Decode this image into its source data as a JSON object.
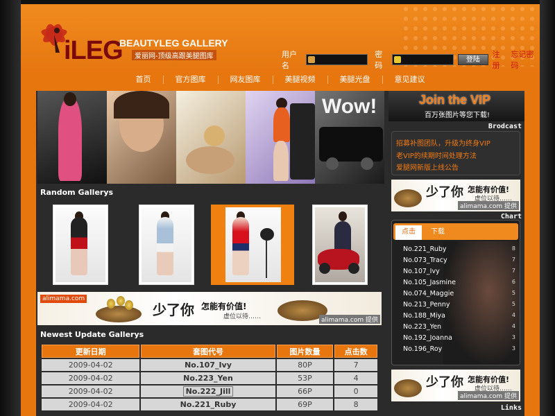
{
  "header": {
    "logo_text": "iLEG",
    "site_title": "BEAUTYLEG GALLERY",
    "slogan": "爱丽网-顶级高跟美腿图库",
    "login": {
      "username_label": "用户名",
      "password_label": "密码",
      "submit_label": "登陆",
      "register_link": "注册",
      "forgot_link": "忘记密码"
    }
  },
  "nav": {
    "items": [
      "首页",
      "官方图库",
      "网友图库",
      "美腿视频",
      "美腿光盘",
      "意见建议"
    ]
  },
  "banner": {
    "wow_text": "Wow!"
  },
  "random_galleries": {
    "title": "Random Gallerys"
  },
  "ad": {
    "brand": "alimama.com",
    "headline": "少了你",
    "subline": "怎能有价值!",
    "waiting": "虚位以待……",
    "provider": "alimama.com 提供"
  },
  "newest": {
    "title": "Newest Update Gallerys",
    "columns": [
      "更新日期",
      "套图代号",
      "图片数量",
      "点击数"
    ],
    "rows": [
      [
        "2009-04-02",
        "No.107_Ivy",
        "80P",
        "7"
      ],
      [
        "2009-04-02",
        "No.223_Yen",
        "53P",
        "4"
      ],
      [
        "2009-04-02",
        "No.222_Jill",
        "66P",
        "0"
      ],
      [
        "2009-04-02",
        "No.221_Ruby",
        "69P",
        "8"
      ]
    ]
  },
  "sidebar": {
    "vip_title": "Join the VIP",
    "vip_sub": "百万张图片等您下载!",
    "broadcast_label": "Brodcast",
    "broadcast_items": [
      "招募补图团队，升级为终身VIP",
      "老VIP的续期时间处理方法",
      "爱腿网新版上线公告"
    ],
    "chart_label": "Chart",
    "links_label": "Links",
    "tabs": [
      "点击",
      "下载"
    ],
    "rankings": [
      {
        "name": "No.221_Ruby",
        "value": "8"
      },
      {
        "name": "No.073_Tracy",
        "value": "7"
      },
      {
        "name": "No.107_Ivy",
        "value": "7"
      },
      {
        "name": "No.105_Jasmine",
        "value": "6"
      },
      {
        "name": "No.074_Maggie",
        "value": "5"
      },
      {
        "name": "No.213_Penny",
        "value": "5"
      },
      {
        "name": "No.188_Miya",
        "value": "4"
      },
      {
        "name": "No.223_Yen",
        "value": "4"
      },
      {
        "name": "No.192_Joanna",
        "value": "3"
      },
      {
        "name": "No.196_Roy",
        "value": "3"
      }
    ]
  },
  "colors": {
    "brand_orange": "#e8760f",
    "dark_panel": "#2b2b2b",
    "link_orange": "#f07a14",
    "logo_red": "#7a0a0a"
  }
}
